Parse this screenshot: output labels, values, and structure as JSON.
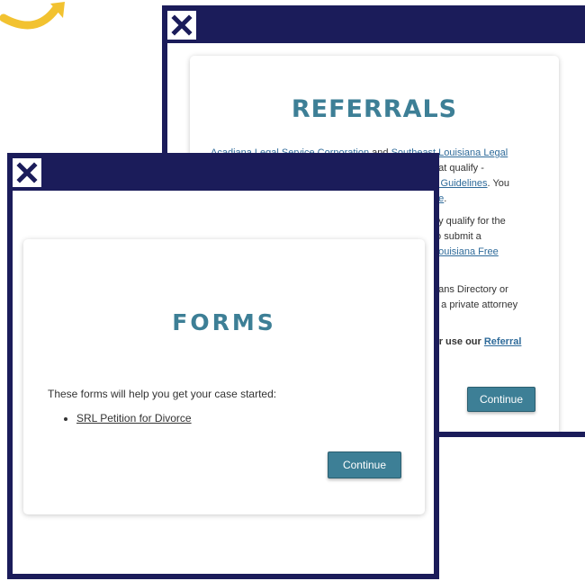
{
  "colors": {
    "frame": "#1b1c5a",
    "accent": "#3d7f96",
    "link": "#2f6b9a",
    "arrow": "#f2c230"
  },
  "referrals_window": {
    "close_icon": "close-x-icon",
    "title": "REFERRALS",
    "lines": [
      {
        "a": "Acadiana Legal Service Corporation",
        "b": " and ",
        "c": "Southeast Louisiana Legal"
      },
      {
        "a": "",
        "b": "hat qualify -",
        "c": ""
      },
      {
        "a": "",
        "b": "",
        "c": "y Guidelines",
        "d": ". You"
      },
      {
        "a": "",
        "b": "",
        "c": "ne",
        "d": "."
      },
      {
        "a": "",
        "b": "ay qualify for the",
        "c": ""
      },
      {
        "a": "",
        "b": "to submit a",
        "c": ""
      },
      {
        "a": "",
        "b": "",
        "c": "Louisiana Free"
      },
      {
        "a": "",
        "b": "eans Directory or",
        "c": ""
      },
      {
        "a": "",
        "b": "d a private attorney",
        "c": ""
      },
      {
        "a": "",
        "b": "or use our ",
        "c": "Referral"
      }
    ],
    "continue_label": "Continue"
  },
  "forms_window": {
    "close_icon": "close-x-icon",
    "title": "FORMS",
    "intro": "These forms will help you get your case started:",
    "forms": [
      "SRL Petition for Divorce"
    ],
    "continue_label": "Continue"
  }
}
